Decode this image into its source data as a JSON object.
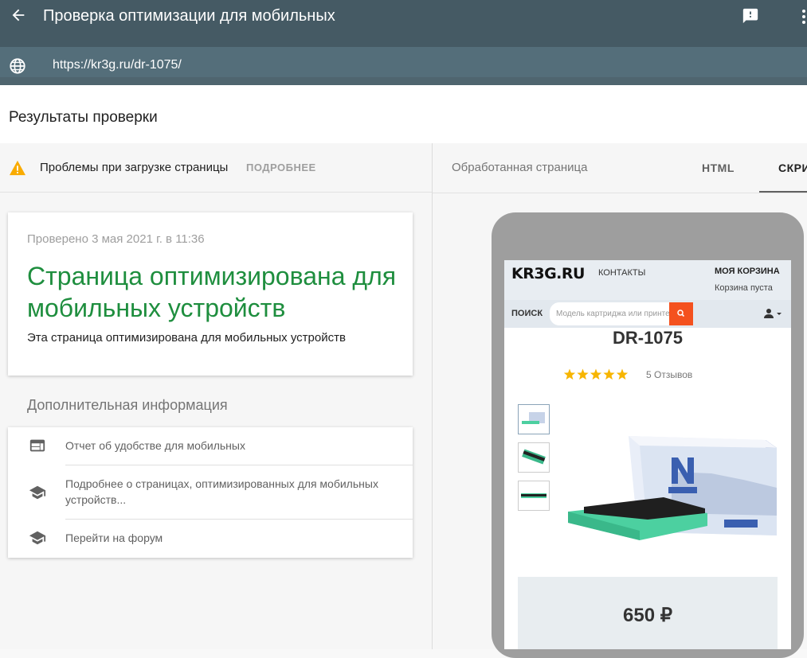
{
  "appbar": {
    "title": "Проверка оптимизации для мобильных"
  },
  "urlbar": {
    "url": "https://kr3g.ru/dr-1075/"
  },
  "results": {
    "heading": "Результаты проверки"
  },
  "warning": {
    "text": "Проблемы при загрузке страницы",
    "link": "ПОДРОБНЕЕ"
  },
  "verdict_card": {
    "checked": "Проверено 3 мая 2021 г. в 11:36",
    "verdict": "Страница оптимизирована для мобильных устройств",
    "description": "Эта страница оптимизирована для мобильных устройств",
    "verdict_color": "#1e8e3e"
  },
  "additional": {
    "heading": "Дополнительная информация",
    "items": [
      {
        "label": "Отчет об удобстве для мобильных",
        "icon": "web-icon"
      },
      {
        "label": "Подробнее о страницах, оптимизированных для мобильных устройств...",
        "icon": "school-icon"
      },
      {
        "label": "Перейти на форум",
        "icon": "school-icon"
      }
    ]
  },
  "preview": {
    "rendered_label": "Обработанная страница",
    "tabs": [
      "HTML",
      "СКРИНШОТ"
    ],
    "active_tab": 1
  },
  "site": {
    "logo": "KR3G.RU",
    "contacts": "КОНТАКТЫ",
    "cart_title": "МОЯ КОРЗИНА",
    "cart_status": "Корзина пуста",
    "search_label": "ПОИСК",
    "search_placeholder": "Модель картриджа или принтера",
    "product_title": "DR-1075",
    "rating": 5,
    "reviews": "5 Отзывов",
    "price": "650 ₽",
    "accent_color": "#f4511e"
  }
}
